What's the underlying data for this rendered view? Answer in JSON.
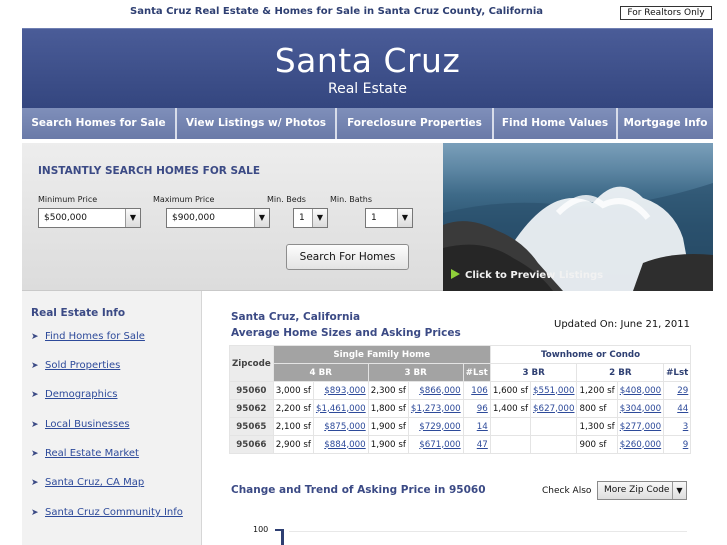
{
  "top": {
    "title": "Santa Cruz Real Estate & Homes for Sale in Santa Cruz County, California",
    "realtors_button": "For Realtors Only"
  },
  "header": {
    "title": "Santa Cruz",
    "subtitle": "Real Estate"
  },
  "nav": [
    {
      "label": "Search Homes for Sale"
    },
    {
      "label": "View Listings w/ Photos"
    },
    {
      "label": "Foreclosure Properties"
    },
    {
      "label": "Find Home Values"
    },
    {
      "label": "Mortgage Info"
    }
  ],
  "search": {
    "title": "INSTANTLY SEARCH HOMES FOR SALE",
    "min_price_label": "Minimum Price",
    "min_price_value": "$500,000",
    "max_price_label": "Maximum Price",
    "max_price_value": "$900,000",
    "beds_label": "Min. Beds",
    "beds_value": "1",
    "baths_label": "Min. Baths",
    "baths_value": "1",
    "button": "Search For Homes",
    "arrow_glyph": "▼"
  },
  "photo": {
    "caption": "Click to Preview Listings"
  },
  "sidebar": {
    "title": "Real Estate Info",
    "bullet": "➤",
    "links": [
      "Find Homes for Sale",
      "Sold Properties",
      "Demographics",
      "Local Businesses",
      "Real Estate Market",
      "Santa Cruz, CA Map",
      "Santa Cruz Community Info"
    ]
  },
  "main": {
    "city": "Santa Cruz, California",
    "subtitle": "Average Home Sizes and Asking Prices",
    "updated": "Updated On: June 21, 2011",
    "table": {
      "zip_header": "Zipcode",
      "sfh_header": "Single Family Home",
      "th_header": "Townhome or Condo",
      "sub_headers": [
        "4 BR",
        "3 BR",
        "#Lst",
        "3 BR",
        "2 BR",
        "#Lst"
      ],
      "rows": [
        [
          "95060",
          "3,000 sf",
          "$893,000",
          "2,300 sf",
          "$866,000",
          "106",
          "1,600 sf",
          "$551,000",
          "1,200 sf",
          "$408,000",
          "29"
        ],
        [
          "95062",
          "2,200 sf",
          "$1,461,000",
          "1,800 sf",
          "$1,273,000",
          "96",
          "1,400 sf",
          "$627,000",
          "800 sf",
          "$304,000",
          "44"
        ],
        [
          "95065",
          "2,100 sf",
          "$875,000",
          "1,900 sf",
          "$729,000",
          "14",
          "",
          "",
          "1,300 sf",
          "$277,000",
          "3"
        ],
        [
          "95066",
          "2,900 sf",
          "$884,000",
          "1,900 sf",
          "$671,000",
          "47",
          "",
          "",
          "900 sf",
          "$260,000",
          "9"
        ]
      ]
    },
    "trend_title": "Change and Trend of Asking Price in 95060",
    "check_also": "Check Also",
    "zip_select": "More Zip Code",
    "chart_y_label": "100"
  }
}
